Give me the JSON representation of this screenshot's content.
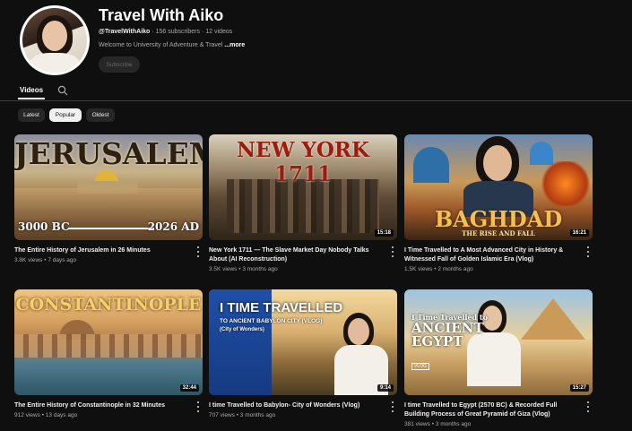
{
  "channel": {
    "name": "Travel With Aiko",
    "handle": "@TravelWithAiko",
    "stats": "· 156 subscribers · 12 videos",
    "description": "Welcome to University of Adventure & Travel ",
    "more_label": "...more",
    "subscribe_label": "Subscribe"
  },
  "tabs": {
    "videos_label": "Videos"
  },
  "filters": [
    "Latest",
    "Popular",
    "Oldest"
  ],
  "selected_filter": "Popular",
  "videos": [
    {
      "thumb_text": "JERUSALEM",
      "thumb_left": "3000 BC",
      "thumb_right": "2026 AD",
      "duration": "",
      "title": "The Entire History of Jerusalem in 26 Minutes",
      "meta": "3.8K views • 7 days ago"
    },
    {
      "thumb_text": "NEW YORK 1711",
      "duration": "15:18",
      "title": "New York 1711 — The Slave Market Day Nobody Talks About (AI Reconstruction)",
      "meta": "3.5K views • 3 months ago"
    },
    {
      "thumb_text": "BAGHDAD",
      "thumb_sub": "THE RISE AND FALL",
      "duration": "16:21",
      "title": "I Time Travelled to A Most Advanced City in History & Witnessed Fall of  Golden Islamic Era (Vlog)",
      "meta": "1.5K views • 2 months ago"
    },
    {
      "thumb_text": "CONSTANTINOPLE",
      "duration": "32:44",
      "title": "The Entire History of Constantinople in 32 Minutes",
      "meta": "912 views • 13 days ago"
    },
    {
      "thumb_text": "I TIME TRAVELLED",
      "thumb_sub": "TO ANCIENT BABYLON CITY (VLOG)",
      "thumb_sub2": "(City of Wonders)",
      "duration": "9:14",
      "title": "I time Travelled to Babylon- City of Wonders (Vlog)",
      "meta": "707 views • 3 months ago"
    },
    {
      "thumb_text": "I Time Travelled to",
      "thumb_big": "ANCIENT EGYPT",
      "thumb_tag": "VLOG",
      "duration": "15:27",
      "title": "I time Travelled to Egypt (2570 BC) & Recorded Full Building Process of Great Pyramid of Giza (Vlog)",
      "meta": "381 views • 3 months ago"
    }
  ],
  "icons": {
    "search": "search-icon",
    "more": "more-vert-icon"
  }
}
